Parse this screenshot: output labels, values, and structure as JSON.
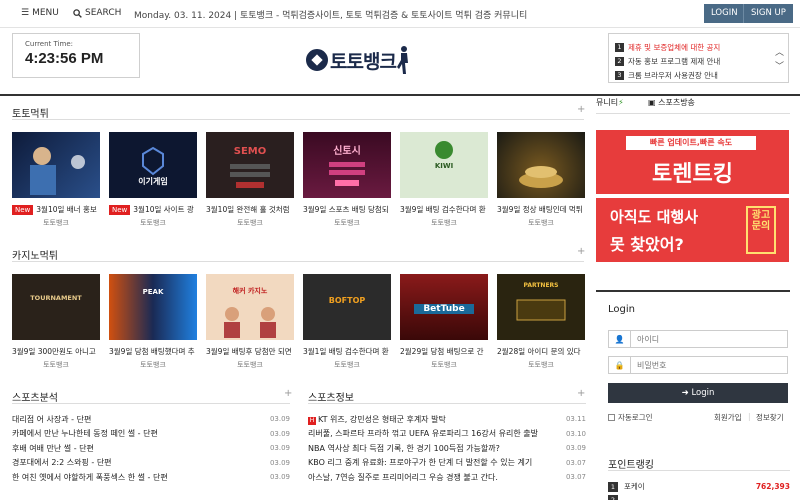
{
  "topbar": {
    "menu_label": "MENU",
    "search_label": "SEARCH",
    "date_text": "Monday. 03. 11. 2024  |  토토뱅크 - 먹튀검증사이트, 토토 먹튀검증 & 토토사이트 먹튀 검증 커뮤니티",
    "login_label": "LOGIN",
    "signup_label": "SIGN UP"
  },
  "header": {
    "clock_label": "Current Time:",
    "clock_time": "4:23:56 PM",
    "logo_text": "토토뱅크",
    "notices": [
      {
        "num": "1",
        "text": "제휴 및 보증업체에 대한 공지"
      },
      {
        "num": "2",
        "text": "자동 홍보 프로그램 제재 안내"
      },
      {
        "num": "3",
        "text": "크롬 브라우저 사용권장 안내"
      }
    ],
    "notice_up": "︿",
    "notice_down": "﹀"
  },
  "colors": {
    "accent": "#e02020",
    "nav": "#4a6a86",
    "dark": "#2f3640",
    "banner": "#e73c3c"
  },
  "sections": {
    "meogtwi": {
      "title": "토토먹튀",
      "items": [
        {
          "new": "New",
          "caption": "3월10일 배너 홍보",
          "src": "토토뱅크",
          "bg": "#1c2b4a",
          "label": ""
        },
        {
          "new": "New",
          "caption": "3월10일 사이트 광",
          "src": "토토뱅크",
          "bg": "#0d1730",
          "label": "이기게임"
        },
        {
          "new": "",
          "caption": "3월10일 완전해 홀 것처럼",
          "src": "토토뱅크",
          "bg": "#2a1f1f",
          "label": "SEMO"
        },
        {
          "new": "",
          "caption": "3월9일 스포츠 배팅 당첨되",
          "src": "토토뱅크",
          "bg": "#4a0f2a",
          "label": "신토시"
        },
        {
          "new": "",
          "caption": "3월9일 배팅 검수한다며 환",
          "src": "토토뱅크",
          "bg": "#dbe9d3",
          "label": "KIWI"
        },
        {
          "new": "",
          "caption": "3월9일 정상 배팅인데 먹튀",
          "src": "토토뱅크",
          "bg": "#1a1a14",
          "label": ""
        }
      ]
    },
    "casino": {
      "title": "카지노먹튀",
      "items": [
        {
          "caption": "3월9일 300만원도 아니고",
          "src": "토토뱅크",
          "bg": "#2a221a",
          "label": "TOURNAMENT"
        },
        {
          "caption": "3월9일 당첨 배팅했다며 추",
          "src": "토토뱅크",
          "bg": "#1a2a55",
          "label": "PEAK"
        },
        {
          "caption": "3월9일 배팅후 당첨만 되면",
          "src": "토토뱅크",
          "bg": "#f2d9c0",
          "label": "해커 카지노"
        },
        {
          "caption": "3월1일 배팅 검수한다며 환",
          "src": "토토뱅크",
          "bg": "#2b2b2b",
          "label": "BOFTOP"
        },
        {
          "caption": "2월29일 당첨 배팅으로 간",
          "src": "토토뱅크",
          "bg": "#6a1010",
          "label": "BetTube"
        },
        {
          "caption": "2월28일 아이디 문의 있다",
          "src": "토토뱅크",
          "bg": "#2a2410",
          "label": "PARTNERS"
        }
      ]
    },
    "analysis": {
      "title": "스포츠분석",
      "rows": [
        {
          "t": "대리점 어 사장과 - 단편",
          "d": "03.09"
        },
        {
          "t": "카페에서 만난 누나한테 동정 떼인 썰 - 단편",
          "d": "03.09"
        },
        {
          "t": "후배 여배 만난 썰 - 단편",
          "d": "03.09"
        },
        {
          "t": "경포대에서 2:2 스와핑 - 단편",
          "d": "03.09"
        },
        {
          "t": "한 여친 옛에서 야할하게 폭풍섹스 한 썰 - 단편",
          "d": "03.09"
        }
      ]
    },
    "info": {
      "title": "스포츠정보",
      "rows": [
        {
          "hot": "H",
          "t": "KT 위즈, 강민성은 형태군 후계자 발탁",
          "d": "03.11"
        },
        {
          "hot": "",
          "t": "리버풀, 스파르타 프라하 꺾고 UEFA 유로파리그 16강서 유리한 출발",
          "d": "03.10"
        },
        {
          "hot": "",
          "t": "NBA 역사상 최다 득점 기록, 한 경기 100득점 가능할까?",
          "d": "03.09"
        },
        {
          "hot": "",
          "t": "KBO 리그 중계 유료화: 프로야구가 한 단계 더 발전할 수 있는 계기",
          "d": "03.07"
        },
        {
          "hot": "",
          "t": "아스날, 7연승 질주로 프리미어리그 우승 경쟁 불고 간다.",
          "d": "03.07"
        }
      ]
    }
  },
  "sidebar": {
    "tab_community": "뮤니티",
    "tab_sports": "스포츠방송",
    "banner1_top": "빠른 업데이트,빠른 속도",
    "banner1_main": "토렌트킹",
    "banner2_line1": "아직도 대행사",
    "banner2_line2": "못 찾았어?",
    "banner2_side": "광고문의",
    "login": {
      "title": "Login",
      "id_placeholder": "아이디",
      "pw_placeholder": "비밀번호",
      "button": "Login",
      "auto_login": "자동로그인",
      "join": "회원가입",
      "find": "정보찾기"
    },
    "ranking": {
      "title": "포인트랭킹",
      "rows": [
        {
          "num": "1",
          "name": "포케이",
          "pts": "762,393"
        },
        {
          "num": "2",
          "name": "",
          "pts": ""
        }
      ]
    }
  }
}
